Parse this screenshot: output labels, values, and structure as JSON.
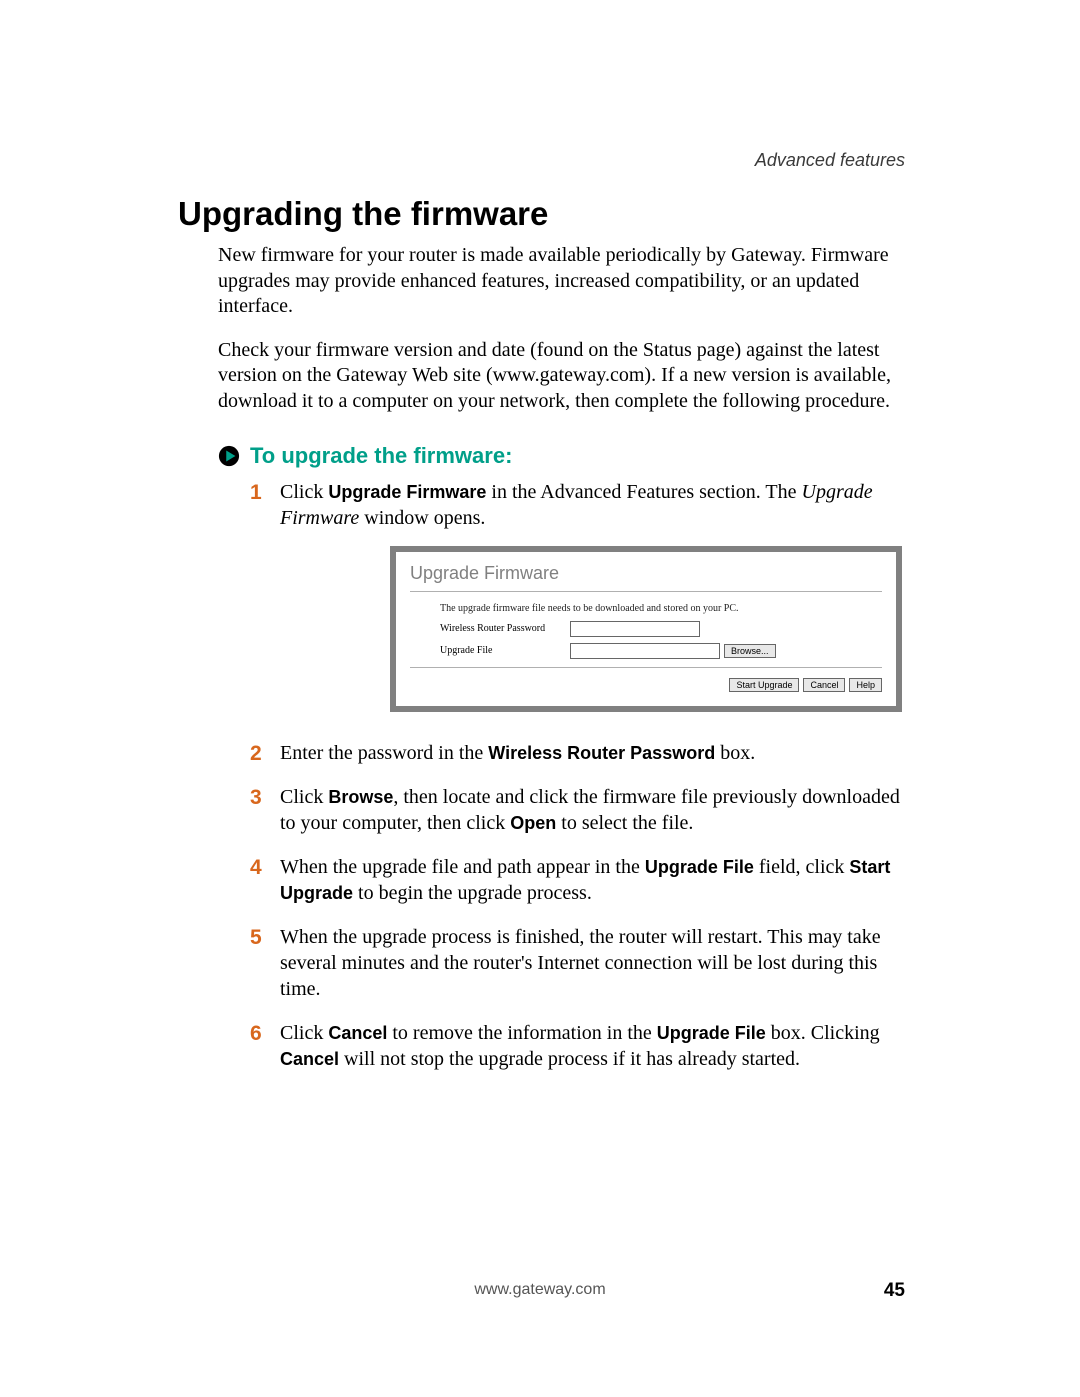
{
  "running_head": "Advanced features",
  "title": "Upgrading the firmware",
  "para1": "New firmware for your router is made available periodically by Gateway. Firmware upgrades may provide enhanced features, increased compatibility, or an updated interface.",
  "para2": "Check your firmware version and date (found on the Status page) against the latest version on the Gateway Web site (www.gateway.com). If a new version is available, download it to a computer on your network, then complete the following procedure.",
  "procedure_title": "To upgrade the firmware:",
  "steps": {
    "s1_a": "Click ",
    "s1_b": "Upgrade Firmware",
    "s1_c": " in the Advanced Features section. The ",
    "s1_d": "Upgrade Firmware",
    "s1_e": " window opens.",
    "s2_a": "Enter the password in the ",
    "s2_b": "Wireless Router Password",
    "s2_c": " box.",
    "s3_a": "Click ",
    "s3_b": "Browse",
    "s3_c": ", then locate and click the firmware file previously downloaded to your computer, then click ",
    "s3_d": "Open",
    "s3_e": " to select the file.",
    "s4_a": "When the upgrade file and path appear in the ",
    "s4_b": "Upgrade File",
    "s4_c": " field, click ",
    "s4_d": "Start Upgrade",
    "s4_e": " to begin the upgrade process.",
    "s5": "When the upgrade process is finished, the router will restart. This may take several minutes and the router's Internet connection will be lost during this time.",
    "s6_a": "Click ",
    "s6_b": "Cancel",
    "s6_c": " to remove the information in the ",
    "s6_d": "Upgrade File",
    "s6_e": " box. Clicking ",
    "s6_f": "Cancel",
    "s6_g": " will not stop the upgrade process if it has already started."
  },
  "screenshot": {
    "window_title": "Upgrade Firmware",
    "description": "The upgrade firmware file needs to be downloaded and stored on your PC.",
    "label_password": "Wireless Router Password",
    "label_file": "Upgrade File",
    "btn_browse": "Browse...",
    "btn_start": "Start Upgrade",
    "btn_cancel": "Cancel",
    "btn_help": "Help"
  },
  "footer_url": "www.gateway.com",
  "page_number": "45"
}
